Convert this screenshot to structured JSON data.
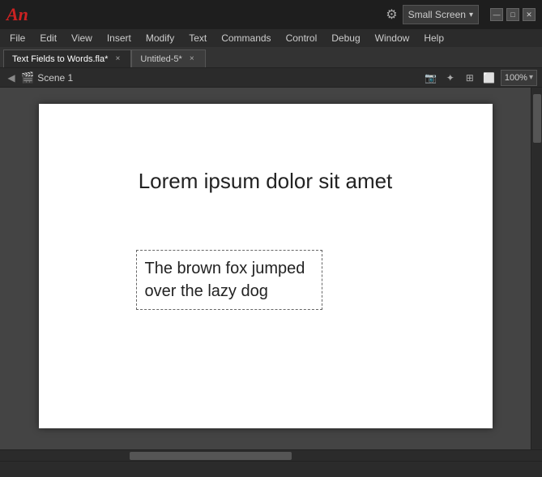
{
  "app": {
    "logo": "An",
    "screen_selector": "Small Screen",
    "chevron": "▾"
  },
  "window_controls": {
    "minimize": "—",
    "maximize": "□",
    "close": "✕"
  },
  "menu": {
    "items": [
      "File",
      "Edit",
      "View",
      "Insert",
      "Modify",
      "Text",
      "Commands",
      "Control",
      "Debug",
      "Window",
      "Help"
    ]
  },
  "tabs": [
    {
      "label": "Text Fields to Words.fla",
      "modified": true,
      "active": true
    },
    {
      "label": "Untitled-5",
      "modified": true,
      "active": false
    }
  ],
  "scene_bar": {
    "scene_name": "Scene 1",
    "zoom": "100%"
  },
  "canvas": {
    "static_text": "Lorem ipsum dolor sit amet",
    "text_field_content": "The brown fox jumped over the lazy dog"
  }
}
